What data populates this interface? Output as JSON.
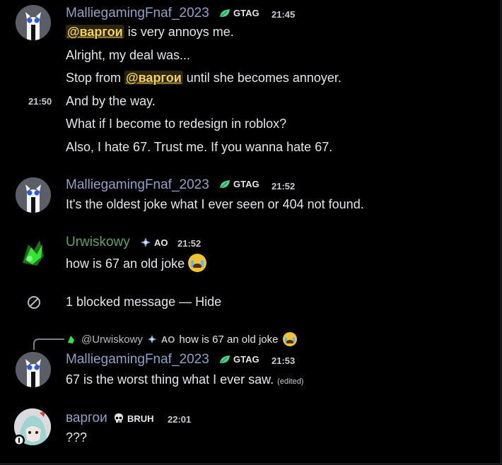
{
  "messages": {
    "group1": {
      "username": "MalliegamingFnaf_2023",
      "tag": "GTAG",
      "time": "21:45",
      "hover_time": "21:50",
      "lines": {
        "l1_mention": "@варгои",
        "l1_text": "is very annoys me.",
        "l2": "Alright, my deal was...",
        "l3_pre": "Stop from",
        "l3_mention": "@варгои",
        "l3_post": "until she becomes annoyer.",
        "l4": "And by the way.",
        "l5": "What if I become to redesign in roblox?",
        "l6": "Also, I hate 67. Trust me. If you wanna hate 67."
      }
    },
    "group2": {
      "username": "MalliegamingFnaf_2023",
      "tag": "GTAG",
      "time": "21:52",
      "text": "It's the oldest joke what I ever seen or 404 not found."
    },
    "group3": {
      "username": "Urwiskowy",
      "tag": "AO",
      "time": "21:52",
      "text": "how is 67 an old joke"
    },
    "blocked": {
      "text": "1 blocked message — Hide"
    },
    "group4": {
      "reply_user": "@Urwiskowy",
      "reply_tag": "AO",
      "reply_text": "how is 67 an old joke",
      "username": "MalliegamingFnaf_2023",
      "tag": "GTAG",
      "time": "21:53",
      "text": "67 is the worst thing what I ever saw.",
      "edited": "(edited)"
    },
    "group5": {
      "username": "варгои",
      "tag": "BRUH",
      "time": "22:01",
      "text": "???"
    }
  },
  "colors": {
    "username_mallie": "#8fa1c8",
    "username_urwiskowy": "#5fa35f",
    "username_vargoi": "#8fa1c8",
    "mention": "#f5d25a",
    "background": "#000000"
  },
  "icons": {
    "gtag": "green-leaf-icon",
    "ao": "diamond-sparkle-icon",
    "bruh": "skull-icon",
    "blocked": "blocked-circle-icon",
    "crying": "loudly-crying-face-icon"
  }
}
